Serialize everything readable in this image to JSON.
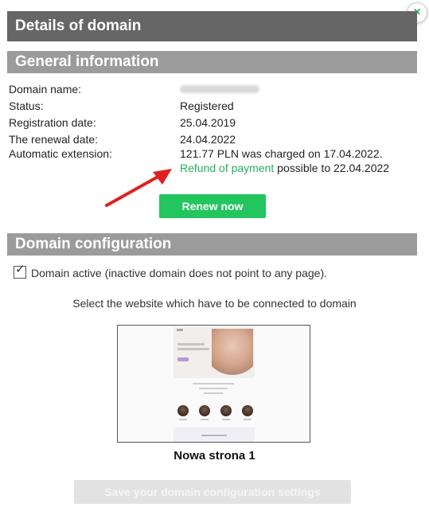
{
  "dialog": {
    "title": "Details of domain",
    "close_label": "×"
  },
  "general": {
    "heading": "General information",
    "rows": [
      {
        "label": "Domain name:",
        "value": ""
      },
      {
        "label": "Status:",
        "value": "Registered"
      },
      {
        "label": "Registration date:",
        "value": "25.04.2019"
      },
      {
        "label": "The renewal date:",
        "value": "24.04.2022"
      },
      {
        "label": "Automatic extension:",
        "value": "121.77 PLN was charged on 17.04.2022."
      }
    ],
    "refund_link": "Refund of payment",
    "refund_suffix": " possible to 22.04.2022",
    "renew_button": "Renew now"
  },
  "config": {
    "heading": "Domain configuration",
    "active_label": "Domain active (inactive domain does not point to any page).",
    "active_checked": true,
    "select_text": "Select the website which have to be connected to domain",
    "website_name": "Nowa strona 1",
    "save_button": "Save your domain configuration settings"
  },
  "colors": {
    "title_bar": "#666666",
    "section_bar": "#9b9b9b",
    "accent_green": "#22c55e",
    "refund_green": "#27ae60",
    "annotation_arrow": "#e02020"
  }
}
